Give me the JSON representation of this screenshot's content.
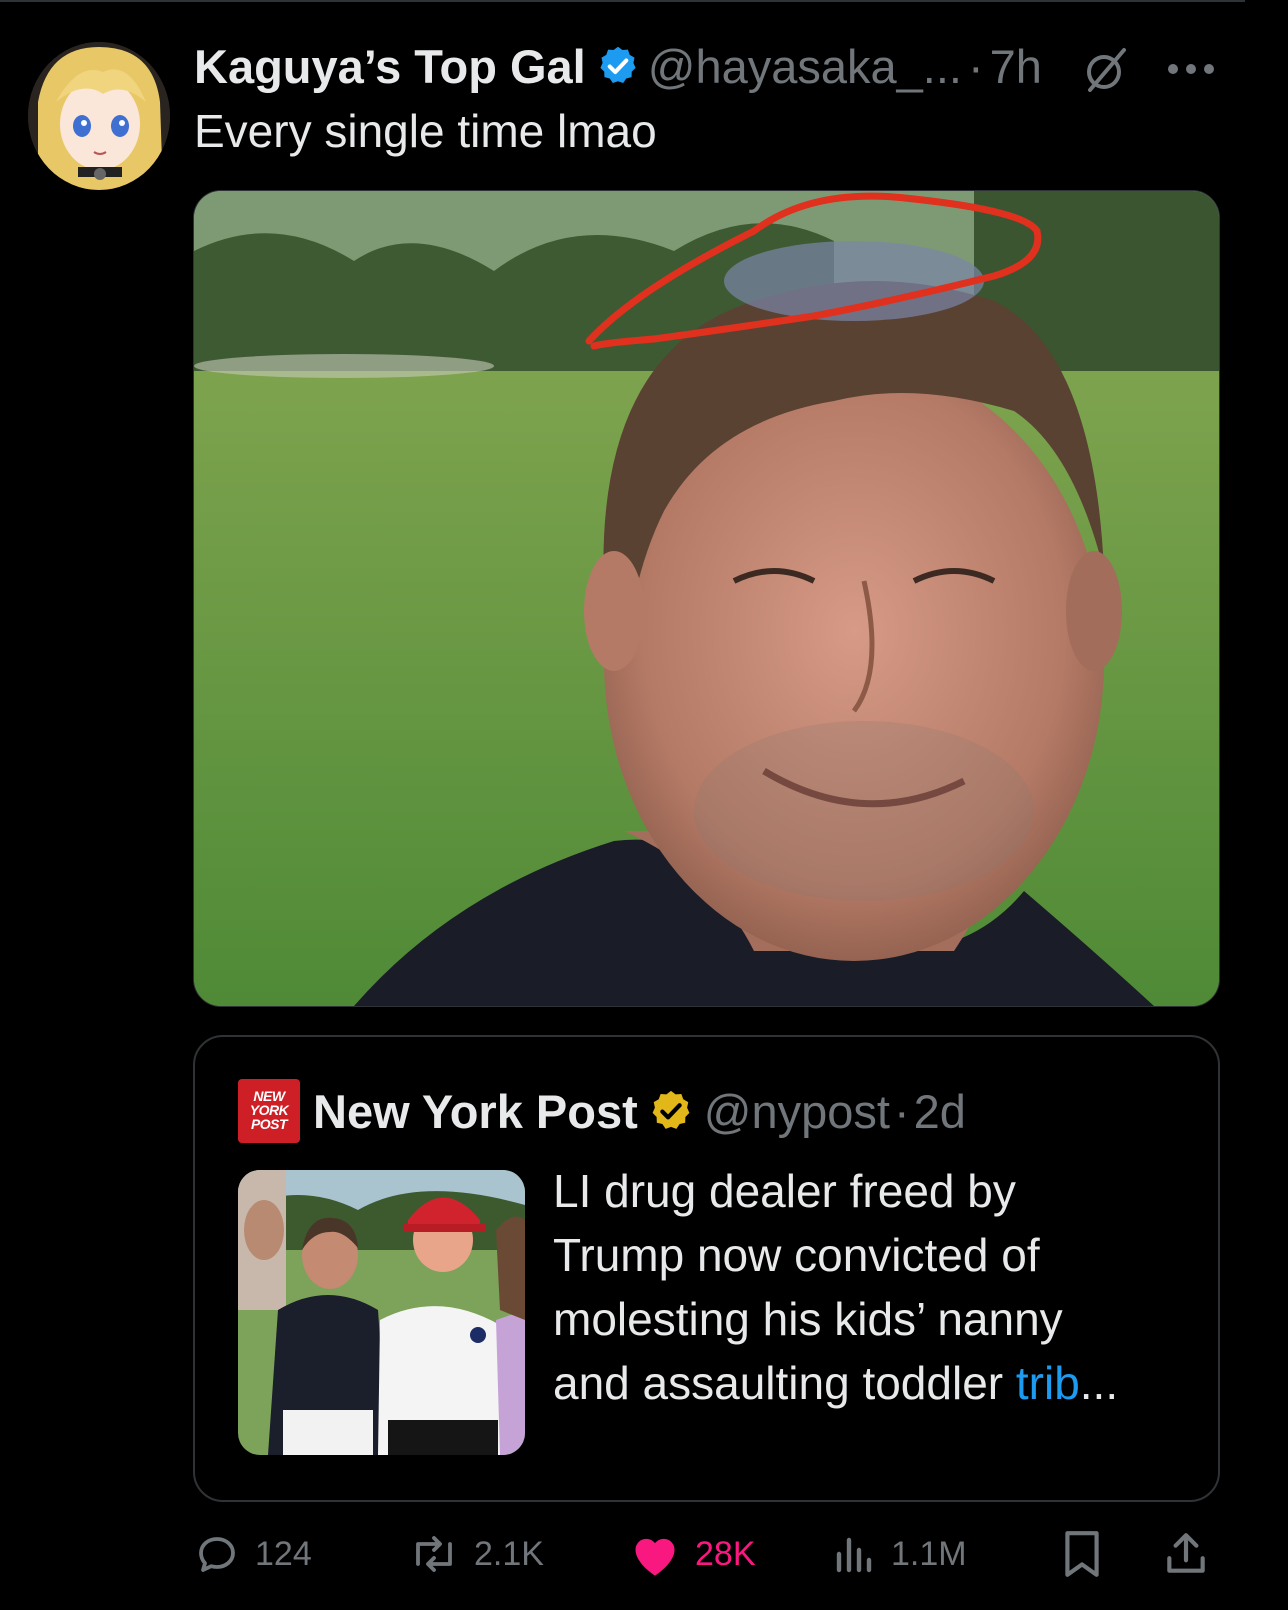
{
  "tweet": {
    "author_name": "Kaguya’s Top Gal",
    "handle": "@hayasaka_...",
    "separator": "·",
    "time": "7h",
    "text": "Every single time lmao"
  },
  "quote": {
    "logo_lines": [
      "NEW",
      "YORK",
      "POST"
    ],
    "author_name": "New York Post",
    "handle": "@nypost",
    "separator": "·",
    "time": "2d",
    "headline_lines": [
      "LI drug dealer freed by",
      "Trump now convicted of",
      "molesting his kids’ nanny",
      "and assaulting toddler "
    ],
    "link_text": "trib",
    "ellipsis": "..."
  },
  "actions": {
    "replies": "124",
    "reposts": "2.1K",
    "likes": "28K",
    "views": "1.1M"
  },
  "colors": {
    "background": "#000000",
    "text_primary": "#e7e9ea",
    "text_secondary": "#71767b",
    "verified_blue": "#1d9bf0",
    "verified_gold": "#e2b719",
    "like_pink": "#f91880",
    "link_blue": "#1d9bf0",
    "nypost_red": "#cf1f26",
    "annotation_red": "#e0301e"
  },
  "icons": {
    "verified": "verified-blue-icon",
    "grok": "grok-icon",
    "more": "more-dots-icon",
    "reply": "reply-icon",
    "repost": "repost-icon",
    "like": "heart-icon",
    "views": "views-icon",
    "bookmark": "bookmark-icon",
    "share": "share-icon"
  }
}
